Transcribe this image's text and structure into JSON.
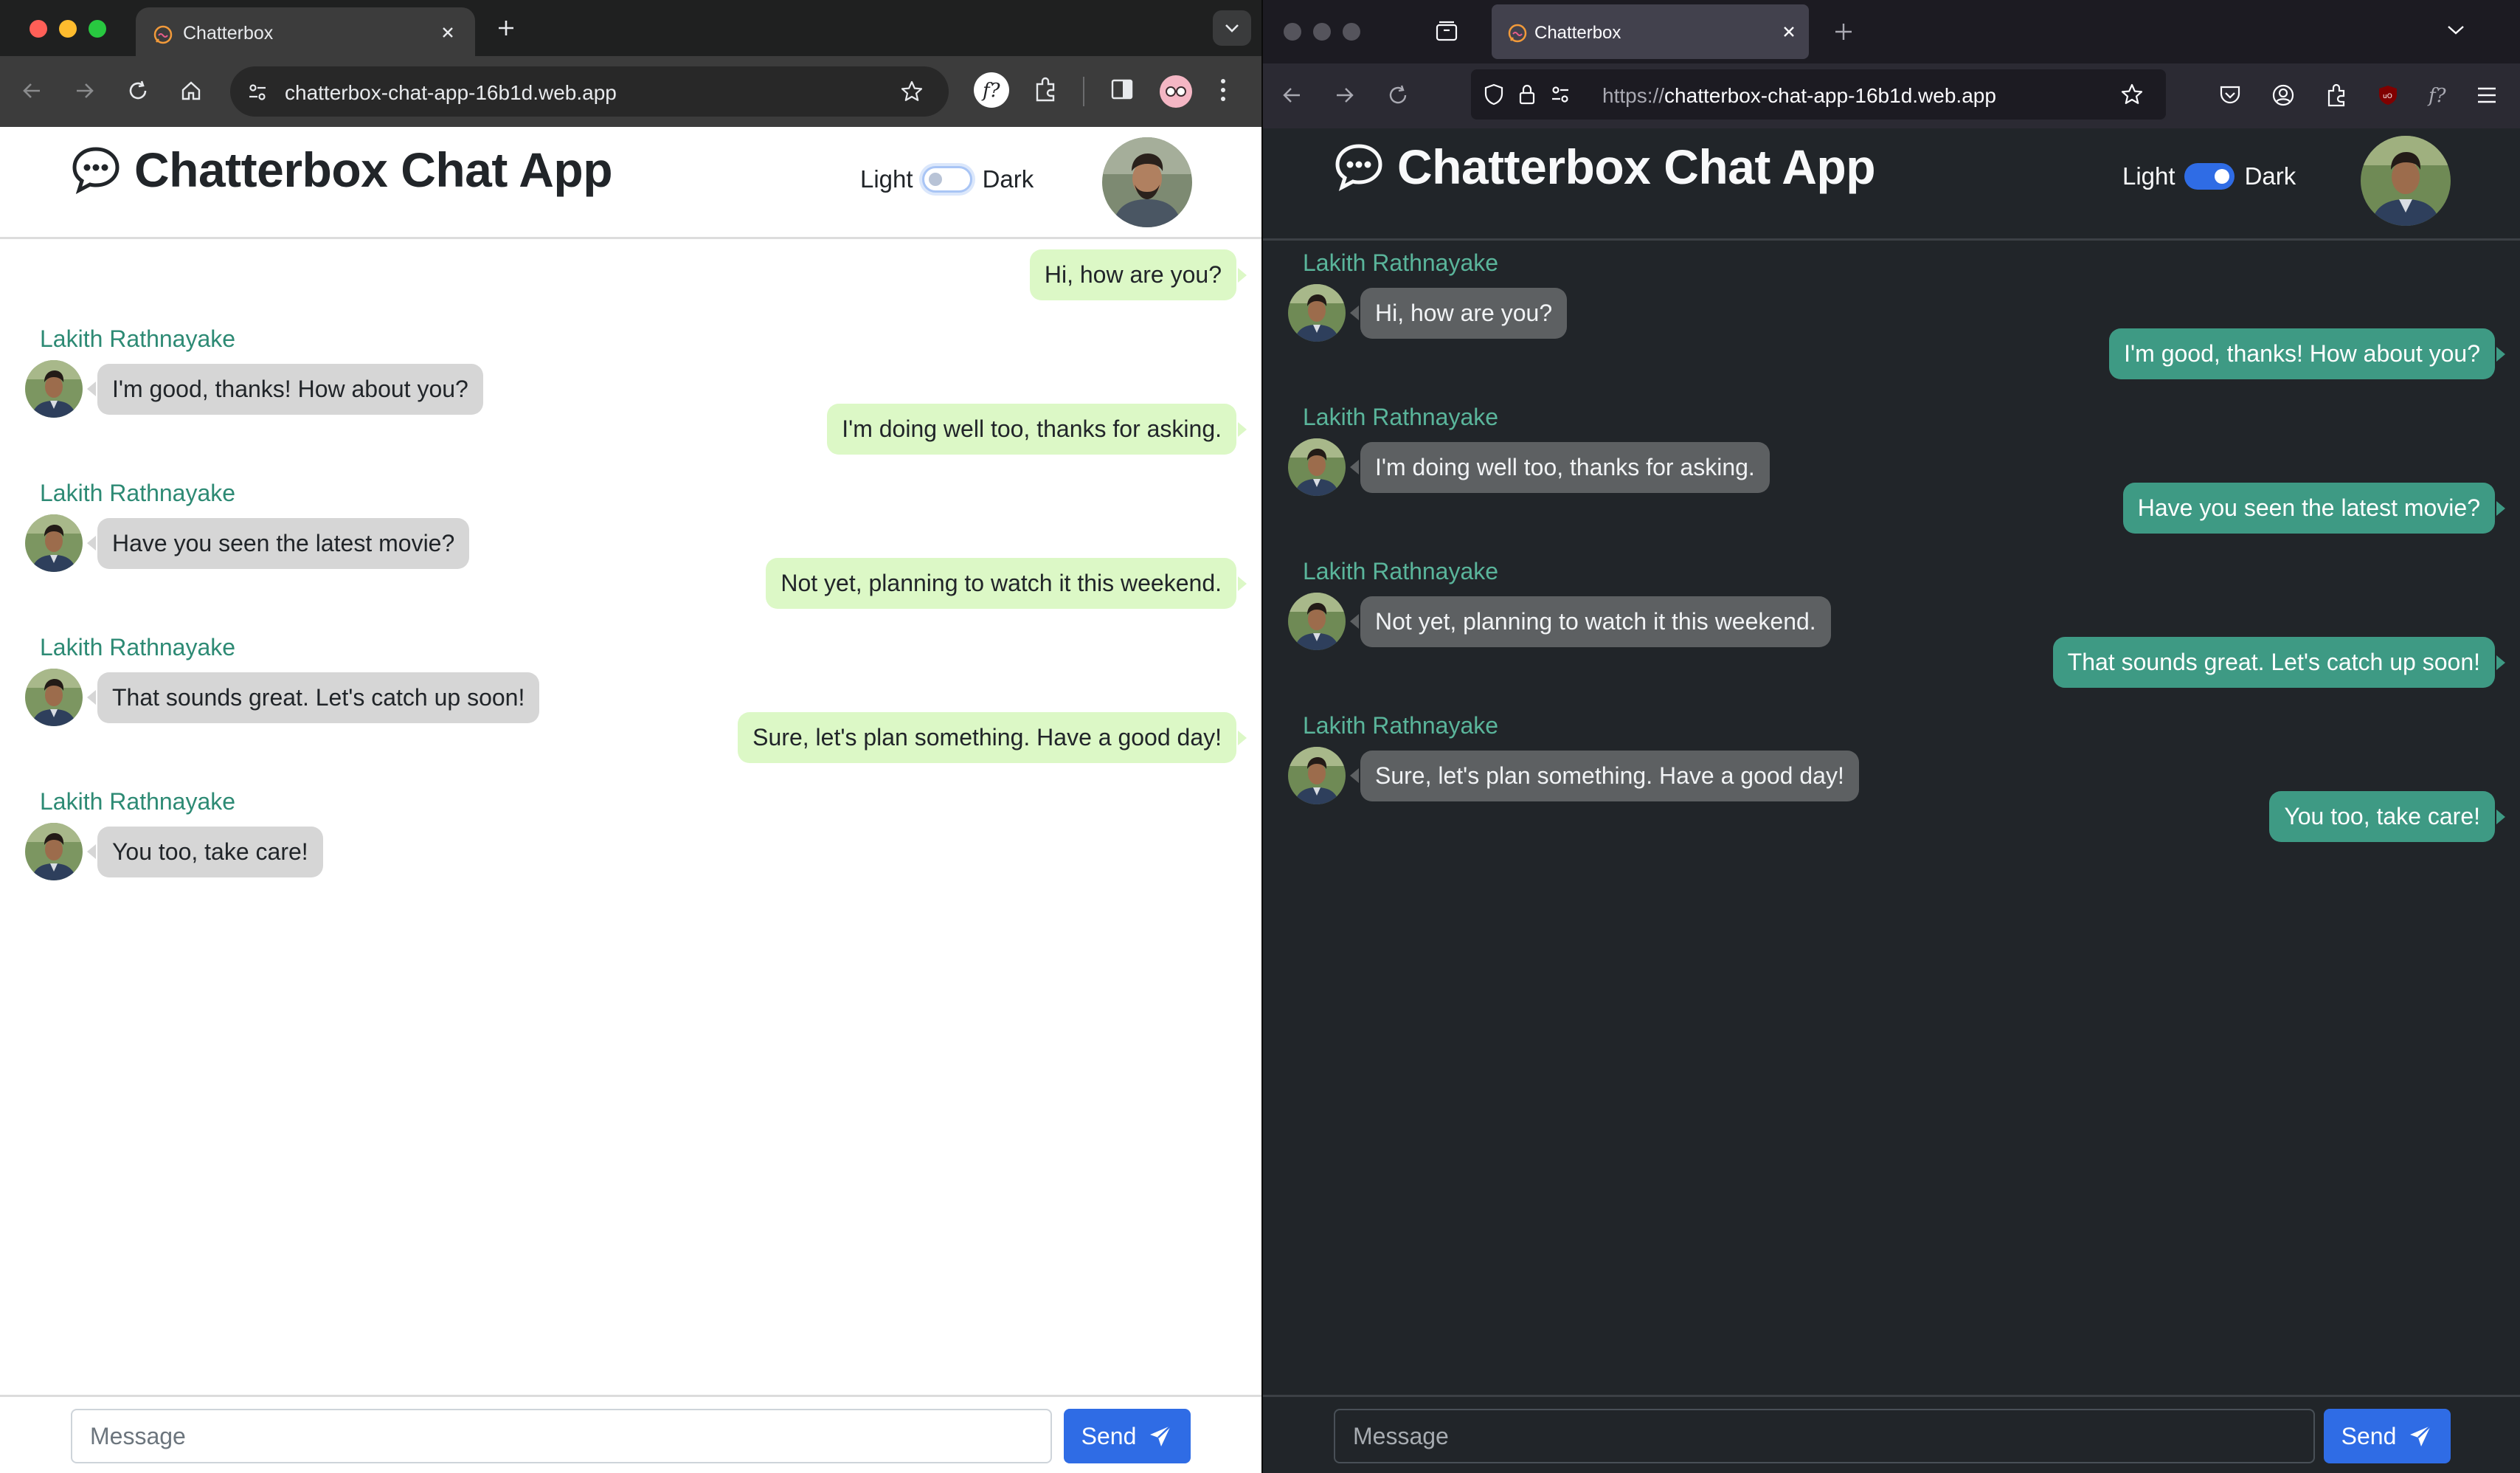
{
  "colors": {
    "accent": "#2f6ce5",
    "sender_name_light": "#2d8a74",
    "sender_name_dark": "#5ab59b",
    "bubble_out_light": "#dcf8c6",
    "bubble_out_dark": "#3e9a84",
    "bubble_in_light": "#d6d6d6",
    "bubble_in_dark": "#5d6062",
    "dark_bg": "#212529"
  },
  "chrome": {
    "tab_title": "Chatterbox",
    "url": "chatterbox-chat-app-16b1d.web.app",
    "icons": [
      "back-icon",
      "forward-icon",
      "reload-icon",
      "home-icon",
      "site-info-icon",
      "bookmark-star-icon",
      "font-finder-extension-icon",
      "extensions-icon",
      "side-panel-icon",
      "profile-icon",
      "menu-icon"
    ]
  },
  "firefox": {
    "tab_title": "Chatterbox",
    "url_scheme": "https://",
    "url_host": "chatterbox-chat-app-16b1d.web.app",
    "icons": [
      "back-icon",
      "forward-icon",
      "reload-icon",
      "shield-icon",
      "lock-icon",
      "permissions-icon",
      "bookmark-star-icon",
      "pocket-icon",
      "account-icon",
      "extensions-icon",
      "ublock-icon",
      "font-finder-extension-icon",
      "menu-icon"
    ]
  },
  "app": {
    "title": "Chatterbox Chat App",
    "theme_light_label": "Light",
    "theme_dark_label": "Dark",
    "message_placeholder": "Message",
    "send_label": "Send"
  },
  "light_view": {
    "theme": "light",
    "messages": [
      {
        "side": "out",
        "text": "Hi, how are you?"
      },
      {
        "side": "in",
        "sender": "Lakith Rathnayake",
        "text": "I'm good, thanks! How about you?"
      },
      {
        "side": "out",
        "text": "I'm doing well too, thanks for asking."
      },
      {
        "side": "in",
        "sender": "Lakith Rathnayake",
        "text": "Have you seen the latest movie?"
      },
      {
        "side": "out",
        "text": "Not yet, planning to watch it this weekend."
      },
      {
        "side": "in",
        "sender": "Lakith Rathnayake",
        "text": "That sounds great. Let's catch up soon!"
      },
      {
        "side": "out",
        "text": "Sure, let's plan something. Have a good day!"
      },
      {
        "side": "in",
        "sender": "Lakith Rathnayake",
        "text": "You too, take care!"
      }
    ]
  },
  "dark_view": {
    "theme": "dark",
    "messages": [
      {
        "side": "in",
        "sender": "Lakith Rathnayake",
        "text": "Hi, how are you?"
      },
      {
        "side": "out",
        "text": "I'm good, thanks! How about you?"
      },
      {
        "side": "in",
        "sender": "Lakith Rathnayake",
        "text": "I'm doing well too, thanks for asking."
      },
      {
        "side": "out",
        "text": "Have you seen the latest movie?"
      },
      {
        "side": "in",
        "sender": "Lakith Rathnayake",
        "text": "Not yet, planning to watch it this weekend."
      },
      {
        "side": "out",
        "text": "That sounds great. Let's catch up soon!"
      },
      {
        "side": "in",
        "sender": "Lakith Rathnayake",
        "text": "Sure, let's plan something. Have a good day!"
      },
      {
        "side": "out",
        "text": "You too, take care!"
      }
    ]
  }
}
